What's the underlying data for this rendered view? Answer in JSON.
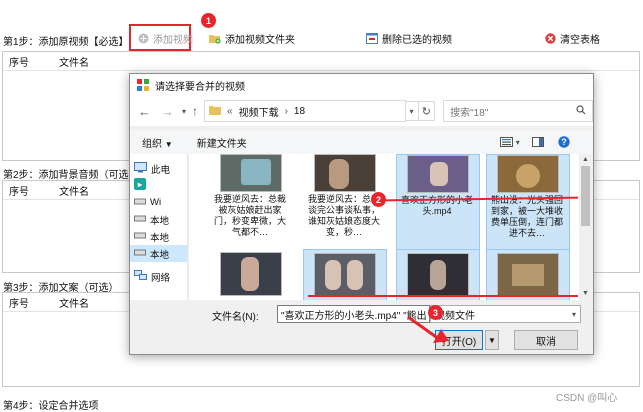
{
  "step1": {
    "label": "第1步：添加原视频【必选】",
    "add_video": "添加视频",
    "add_folder": "添加视频文件夹",
    "delete_selected": "删除已选的视频",
    "clear_table": "清空表格",
    "col_index": "序号",
    "col_filename": "文件名"
  },
  "step2": {
    "label": "第2步：添加背景音频（可选）",
    "col_index": "序号",
    "col_filename": "文件名"
  },
  "step3": {
    "label": "第3步：添加文案（可选）",
    "col_index": "序号",
    "col_filename": "文件名"
  },
  "step4": {
    "label": "第4步：设定合并选项"
  },
  "annotations": {
    "n1": "1",
    "n2": "2",
    "n3": "3"
  },
  "dialog": {
    "title": "请选择要合并的视频",
    "breadcrumb_prefix": "«",
    "breadcrumb": [
      "视频下载",
      "18"
    ],
    "search_placeholder": "搜索\"18\"",
    "organize": "组织",
    "new_folder": "新建文件夹",
    "nav_items": [
      "此电",
      "Wi",
      "本地",
      "本地",
      "本地",
      "网络"
    ],
    "files_row1": [
      {
        "caption": "我要逆风去：总裁被灰姑娘赶出家门，秒变卑微，大气都不…",
        "selected": false
      },
      {
        "caption": "我要逆风去：总裁谈完公事谈私事，谁知灰姑娘态度大变，秒…",
        "selected": false
      },
      {
        "caption": "喜欢正方形的小老头.mp4",
        "selected": true
      },
      {
        "caption": "熊出没：光头强回到家，被一大堆收费单压倒，连门都进不去…",
        "selected": true
      }
    ],
    "filename_label": "文件名(N):",
    "filename_value": "\"喜欢正方形的小老头.mp4\" \"熊出",
    "filetype": "视频文件",
    "open": "打开(O)",
    "cancel": "取消"
  },
  "watermark": "CSDN @叫心"
}
